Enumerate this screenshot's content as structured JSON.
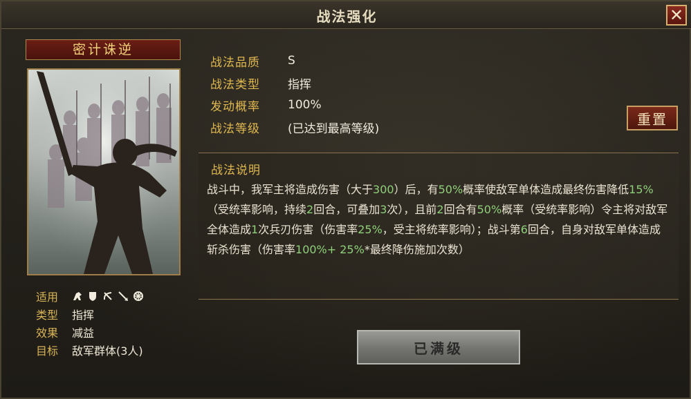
{
  "window": {
    "title": "战法强化"
  },
  "card": {
    "name": "密计诛逆",
    "meta": [
      {
        "label": "适用",
        "value": ""
      },
      {
        "label": "类型",
        "value": "指挥"
      },
      {
        "label": "效果",
        "value": "减益"
      },
      {
        "label": "目标",
        "value": "敌军群体(3人)"
      }
    ],
    "weapon_icons": [
      "cavalry-icon",
      "shield-icon",
      "bow-icon",
      "spear-icon",
      "wheel-icon"
    ]
  },
  "info": [
    {
      "label": "战法品质",
      "value": "S"
    },
    {
      "label": "战法类型",
      "value": "指挥"
    },
    {
      "label": "发动概率",
      "value": "100%"
    },
    {
      "label": "战法等级",
      "value": "(已达到最高等级)"
    }
  ],
  "reset_label": "重置",
  "description": {
    "title": "战法说明",
    "segments": [
      {
        "t": "战斗中，我军主将造成伤害（大于",
        "h": false
      },
      {
        "t": "300",
        "h": true
      },
      {
        "t": "）后，有",
        "h": false
      },
      {
        "t": "50%",
        "h": true
      },
      {
        "t": "概率使敌军单体造成最终伤害降低",
        "h": false
      },
      {
        "t": "15%",
        "h": true
      },
      {
        "t": "（受统率影响，持续",
        "h": false
      },
      {
        "t": "2",
        "h": true
      },
      {
        "t": "回合，可叠加",
        "h": false
      },
      {
        "t": "3",
        "h": true
      },
      {
        "t": "次），且前",
        "h": false
      },
      {
        "t": "2",
        "h": true
      },
      {
        "t": "回合有",
        "h": false
      },
      {
        "t": "50%",
        "h": true
      },
      {
        "t": "概率（受统率影响）令主将对敌军全体造成",
        "h": false
      },
      {
        "t": "1",
        "h": true
      },
      {
        "t": "次兵刃伤害（伤害率",
        "h": false
      },
      {
        "t": "25%",
        "h": true
      },
      {
        "t": "，受主将统率影响）；战斗第",
        "h": false
      },
      {
        "t": "6",
        "h": true
      },
      {
        "t": "回合，自身对敌军单体造成斩杀伤害（伤害率",
        "h": false
      },
      {
        "t": "100%+ 25%",
        "h": true
      },
      {
        "t": "*最终降伤施加次数）",
        "h": false
      }
    ]
  },
  "maxed_label": "已满级",
  "colors": {
    "gold": "#e0b850",
    "highlight": "#8fd07a",
    "red_button": "#7a2a1a"
  }
}
